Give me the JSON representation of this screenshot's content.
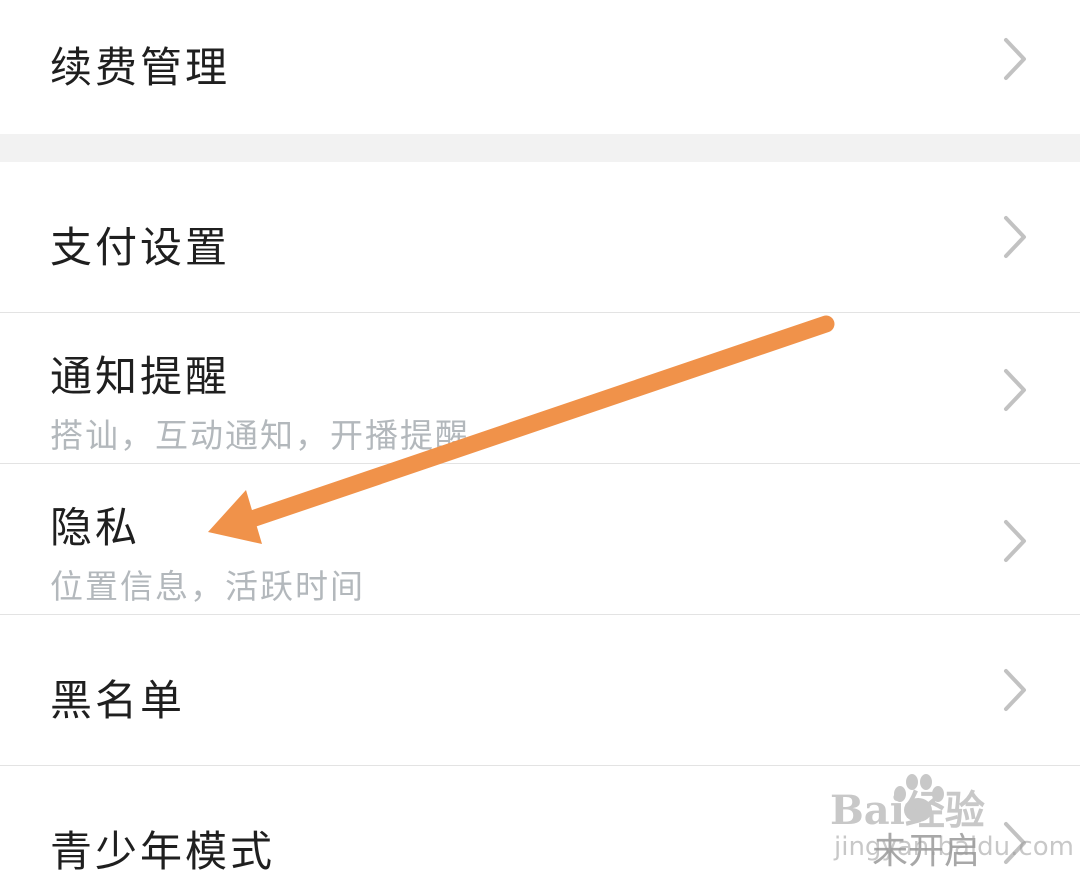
{
  "menu": {
    "renewal": {
      "title": "续费管理"
    },
    "payment": {
      "title": "支付设置"
    },
    "notifications": {
      "title": "通知提醒",
      "subtitle": "搭讪，互动通知，开播提醒"
    },
    "privacy": {
      "title": "隐私",
      "subtitle": "位置信息，活跃时间"
    },
    "blacklist": {
      "title": "黑名单"
    },
    "teen_mode": {
      "title": "青少年模式",
      "value": "未开启"
    }
  },
  "annotation": {
    "arrow_color": "#F0924A",
    "points_to": "privacy"
  },
  "watermark": {
    "brand": "Bai经验",
    "url": "jingyan.baidu.com"
  },
  "icons": {
    "row_chevron": "chevron-right-icon",
    "watermark_logo": "paw-icon"
  },
  "colors": {
    "title_text": "#1F1F1F",
    "subtitle_text": "#B3B8BC",
    "chevron": "#C2C2C2",
    "section_gap": "#F2F2F2",
    "divider": "#E3E3E3"
  }
}
